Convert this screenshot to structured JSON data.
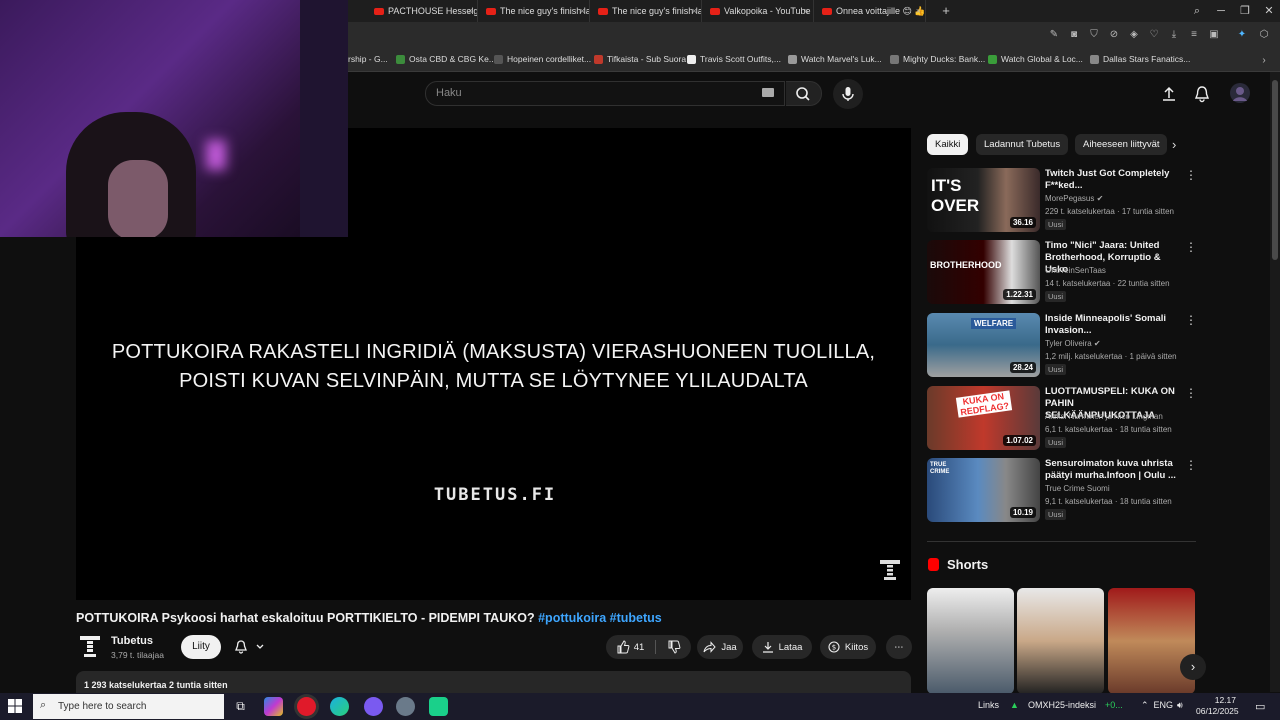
{
  "browser": {
    "tabs": [
      {
        "label": "PACTHOUSE Hesselgren m"
      },
      {
        "label": "The nice guy's finish last"
      },
      {
        "label": "The nice guy's finish last"
      },
      {
        "label": "Valkopoika - YouTube"
      },
      {
        "label": "Onnea voittajille 😊 👍🎉"
      }
    ],
    "bookmarks": [
      {
        "label": "rship - G..."
      },
      {
        "label": "Osta CBD & CBG Ke..."
      },
      {
        "label": "Hopeinen cordelliket..."
      },
      {
        "label": "Tifkaista - Sub Suora"
      },
      {
        "label": "Travis Scott Outfits,..."
      },
      {
        "label": "Watch Marvel's Luk..."
      },
      {
        "label": "Mighty Ducks: Bank..."
      },
      {
        "label": "Watch Global & Loc..."
      },
      {
        "label": "Dallas Stars Fanatics..."
      }
    ]
  },
  "header": {
    "search_placeholder": "Haku"
  },
  "player": {
    "overlay_line1": "POTTUKOIRA RAKASTELI INGRIDIÄ (MAKSUSTA) VIERASHUONEEN TUOLILLA,",
    "overlay_line2": "POISTI KUVAN SELVINPÄIN, MUTTA SE LÖYTYNEE YLILAUDALTA",
    "watermark": "TUBETUS.FI"
  },
  "video": {
    "title": "POTTUKOIRA Psykoosi harhat eskaloituu PORTTIKIELTO - PIDEMPI TAUKO?",
    "hashtags": "#pottukoira #tubetus",
    "channel_name": "Tubetus",
    "channel_subs": "3,79 t. tilaajaa",
    "join_label": "Liity",
    "like_count": "41",
    "share_label": "Jaa",
    "download_label": "Lataa",
    "thanks_label": "Kiitos",
    "description_meta": "1 293 katselukertaa  2 tuntia sitten"
  },
  "sidebar": {
    "chips": [
      "Kaikki",
      "Ladannut Tubetus",
      "Aiheeseen liittyvät"
    ],
    "recommendations": [
      {
        "title": "Twitch Just Got Completely F**ked...",
        "channel": "MorePegasus",
        "meta": "229 t. katselukertaa · 17 tuntia sitten",
        "badge": "Uusi",
        "duration": "36.16",
        "thumb_text": "IT'S OVER"
      },
      {
        "title": "Timo \"Nici\" Jaara: United Brotherhood, Korruptio & Usko",
        "channel": "OhoTeinSenTaas",
        "meta": "14 t. katselukertaa · 22 tuntia sitten",
        "badge": "Uusi",
        "duration": "1.22.31",
        "thumb_text": "BROTHERHOOD"
      },
      {
        "title": "Inside Minneapolis' Somali Invasion...",
        "channel": "Tyler Oliveira",
        "meta": "1,2 milj. katselukertaa · 1 päivä sitten",
        "badge": "Uusi",
        "duration": "28.24",
        "thumb_text": "WELFARE"
      },
      {
        "title": "LUOTTAMUSPELI: KUKA ON PAHIN SELKÄÄNPUUKOTTAJA",
        "channel": "Aleksi Nurminen ja Nico Lingman",
        "meta": "6,1 t. katselukertaa · 18 tuntia sitten",
        "badge": "Uusi",
        "duration": "1.07.02",
        "thumb_text": "KUKA ON REDFLAG?"
      },
      {
        "title": "Sensuroimaton kuva uhrista päätyi murha.Infoon | Oulu ...",
        "channel": "True Crime Suomi",
        "meta": "9,1 t. katselukertaa · 18 tuntia sitten",
        "badge": "Uusi",
        "duration": "10.19",
        "thumb_text": "TRUE CRIME"
      }
    ],
    "shorts_title": "Shorts"
  },
  "taskbar": {
    "search_placeholder": "Type here to search",
    "links_label": "Links",
    "ticker": "OMXH25-indeksi",
    "ticker_change": "+0...",
    "lang": "ENG",
    "time": "12.17",
    "date": "06/12/2025"
  },
  "colors": {
    "yt_red": "#ff0000",
    "link_blue": "#3ea6ff",
    "bg": "#0f0f0f"
  }
}
